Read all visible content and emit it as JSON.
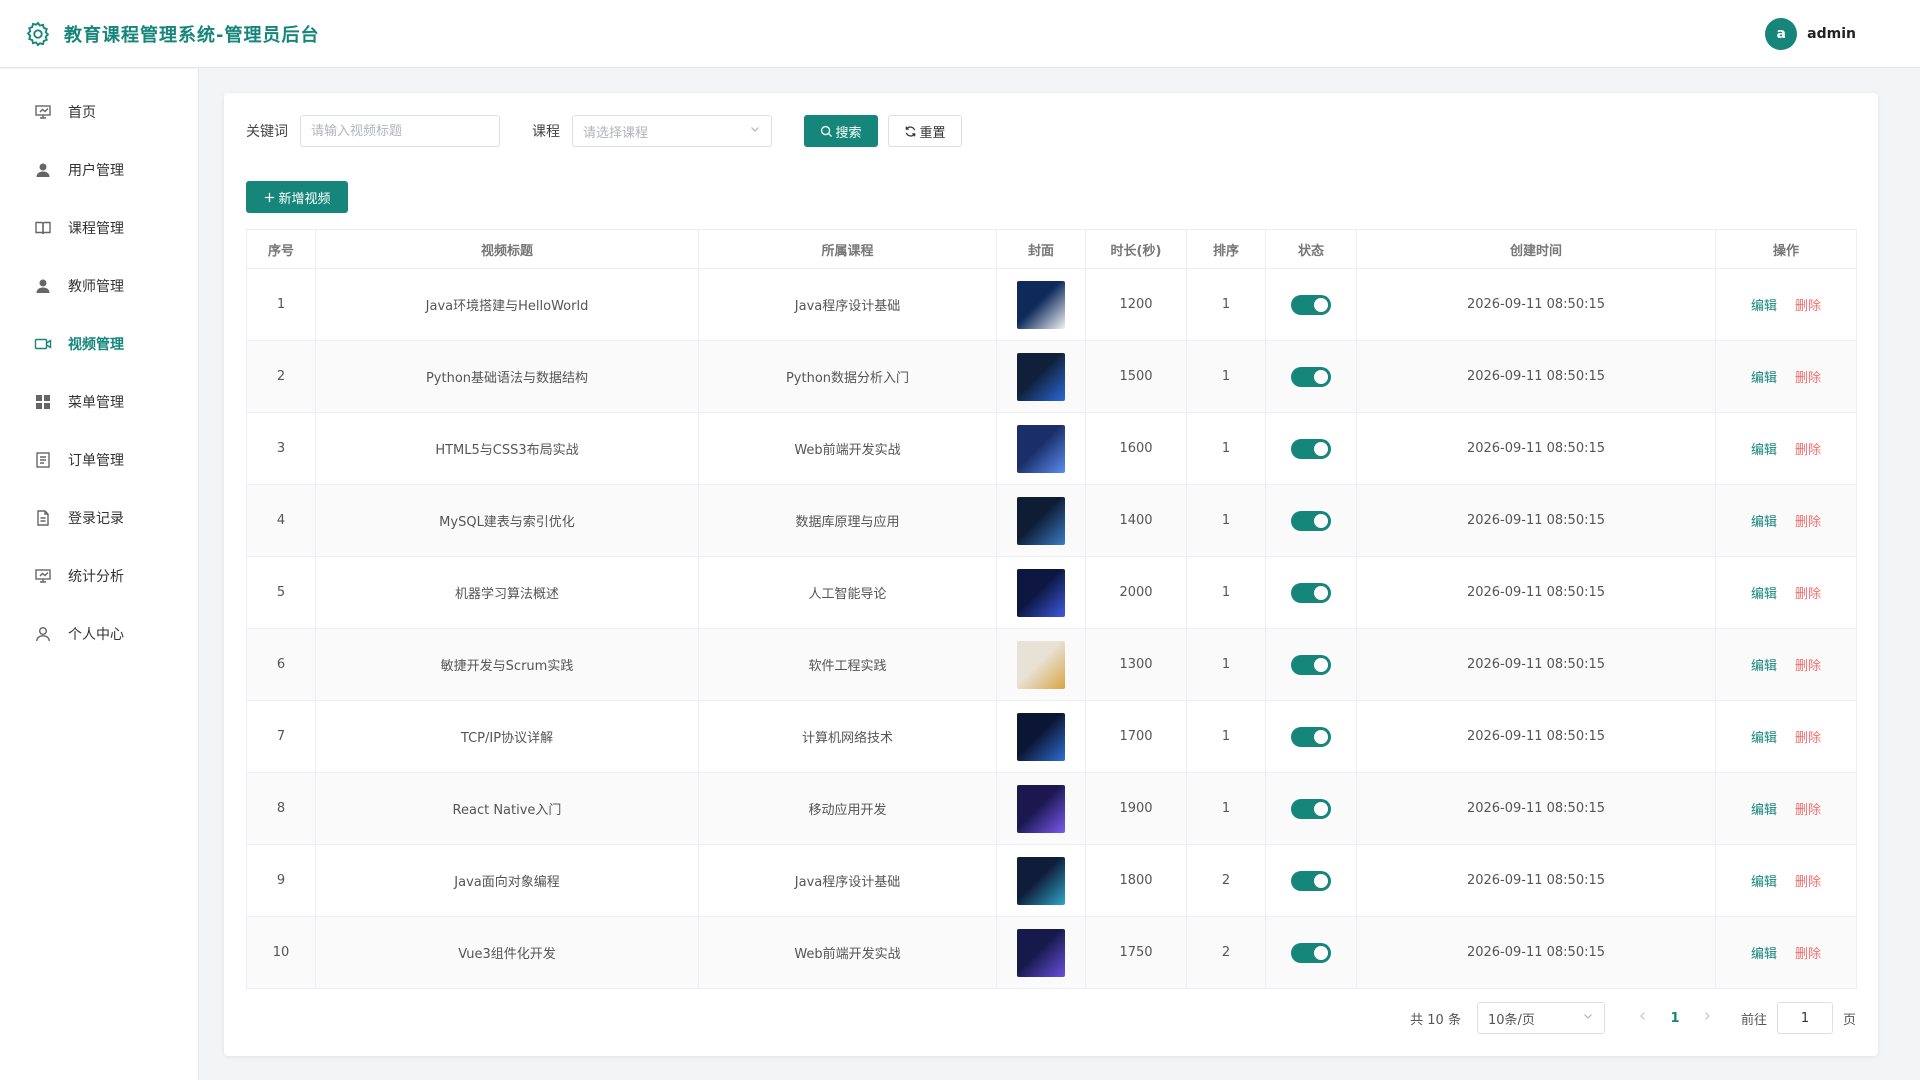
{
  "header": {
    "title": "教育课程管理系统-管理员后台",
    "avatar_letter": "a",
    "username": "admin",
    "accent": "#16867a"
  },
  "sidebar": {
    "items": [
      {
        "label": "首页",
        "icon": "presentation-icon"
      },
      {
        "label": "用户管理",
        "icon": "user-icon"
      },
      {
        "label": "课程管理",
        "icon": "book-icon"
      },
      {
        "label": "教师管理",
        "icon": "user-icon"
      },
      {
        "label": "视频管理",
        "icon": "video-icon",
        "active": true
      },
      {
        "label": "菜单管理",
        "icon": "grid-icon"
      },
      {
        "label": "订单管理",
        "icon": "list-doc-icon"
      },
      {
        "label": "登录记录",
        "icon": "document-icon"
      },
      {
        "label": "统计分析",
        "icon": "presentation-icon"
      },
      {
        "label": "个人中心",
        "icon": "user-outline-icon"
      }
    ]
  },
  "filters": {
    "keyword_label": "关键词",
    "keyword_placeholder": "请输入视频标题",
    "keyword_value": "",
    "course_label": "课程",
    "course_placeholder": "请选择课程",
    "search_label": "搜索",
    "reset_label": "重置"
  },
  "toolbar": {
    "add_label": "新增视频"
  },
  "table": {
    "columns": [
      "序号",
      "视频标题",
      "所属课程",
      "封面",
      "时长(秒)",
      "排序",
      "状态",
      "创建时间",
      "操作"
    ],
    "edit_label": "编辑",
    "delete_label": "删除",
    "rows": [
      {
        "no": "1",
        "title": "Java环境搭建与HelloWorld",
        "course": "Java程序设计基础",
        "duration": "1200",
        "sort": "1",
        "status": true,
        "created": "2026-09-11 08:50:15",
        "cover_colors": [
          "#0d2a5a",
          "#f2f4f8"
        ]
      },
      {
        "no": "2",
        "title": "Python基础语法与数据结构",
        "course": "Python数据分析入门",
        "duration": "1500",
        "sort": "1",
        "status": true,
        "created": "2026-09-11 08:50:15",
        "cover_colors": [
          "#11203a",
          "#2b6ad8"
        ]
      },
      {
        "no": "3",
        "title": "HTML5与CSS3布局实战",
        "course": "Web前端开发实战",
        "duration": "1600",
        "sort": "1",
        "status": true,
        "created": "2026-09-11 08:50:15",
        "cover_colors": [
          "#1a2f6a",
          "#5b8cf0"
        ]
      },
      {
        "no": "4",
        "title": "MySQL建表与索引优化",
        "course": "数据库原理与应用",
        "duration": "1400",
        "sort": "1",
        "status": true,
        "created": "2026-09-11 08:50:15",
        "cover_colors": [
          "#0e1d33",
          "#3b7cc4"
        ]
      },
      {
        "no": "5",
        "title": "机器学习算法概述",
        "course": "人工智能导论",
        "duration": "2000",
        "sort": "1",
        "status": true,
        "created": "2026-09-11 08:50:15",
        "cover_colors": [
          "#0c1640",
          "#3e5be0"
        ]
      },
      {
        "no": "6",
        "title": "敏捷开发与Scrum实践",
        "course": "软件工程实践",
        "duration": "1300",
        "sort": "1",
        "status": true,
        "created": "2026-09-11 08:50:15",
        "cover_colors": [
          "#e8e2d6",
          "#d9a441"
        ]
      },
      {
        "no": "7",
        "title": "TCP/IP协议详解",
        "course": "计算机网络技术",
        "duration": "1700",
        "sort": "1",
        "status": true,
        "created": "2026-09-11 08:50:15",
        "cover_colors": [
          "#0b1634",
          "#2f6fd0"
        ]
      },
      {
        "no": "8",
        "title": "React Native入门",
        "course": "移动应用开发",
        "duration": "1900",
        "sort": "1",
        "status": true,
        "created": "2026-09-11 08:50:15",
        "cover_colors": [
          "#1b1850",
          "#7b5bf0"
        ]
      },
      {
        "no": "9",
        "title": "Java面向对象编程",
        "course": "Java程序设计基础",
        "duration": "1800",
        "sort": "2",
        "status": true,
        "created": "2026-09-11 08:50:15",
        "cover_colors": [
          "#0f1d3a",
          "#2fa7c9"
        ]
      },
      {
        "no": "10",
        "title": "Vue3组件化开发",
        "course": "Web前端开发实战",
        "duration": "1750",
        "sort": "2",
        "status": true,
        "created": "2026-09-11 08:50:15",
        "cover_colors": [
          "#161a4a",
          "#6b4fe0"
        ]
      }
    ]
  },
  "pagination": {
    "total_text": "共 10 条",
    "page_size": "10条/页",
    "current_page": "1",
    "goto_label": "前往",
    "goto_value": "1",
    "page_unit": "页"
  }
}
